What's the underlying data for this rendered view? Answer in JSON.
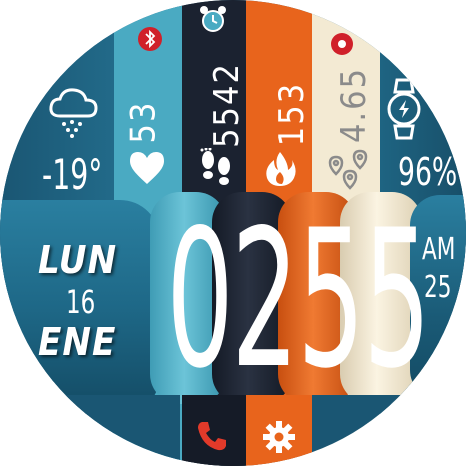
{
  "weather": {
    "icon": "cloud-snow-icon",
    "temperature": "-19°"
  },
  "heart_rate": {
    "icon": "heart-icon",
    "value": "53"
  },
  "steps": {
    "icon": "footsteps-icon",
    "value": "5542"
  },
  "calories": {
    "icon": "flame-icon",
    "value": "153"
  },
  "distance": {
    "icon": "location-pins-icon",
    "value": "4.65"
  },
  "battery": {
    "icon": "watch-battery-icon",
    "value": "96%"
  },
  "status_icons": {
    "bluetooth": "bluetooth-icon",
    "alarm": "alarm-clock-icon",
    "notification": "notification-dot-icon"
  },
  "date": {
    "weekday": "LUN",
    "day": "16",
    "month": "ENE"
  },
  "time": {
    "h1": "0",
    "h2": "2",
    "m1": "5",
    "m2": "5",
    "ampm": "AM",
    "seconds": "25"
  },
  "shortcuts": {
    "phone": "phone-icon",
    "settings": "gear-icon"
  },
  "colors": {
    "teal": "#1c5f7c",
    "light_blue": "#4fb0c6",
    "navy": "#1b2230",
    "orange": "#e8641c",
    "cream": "#f3ead3",
    "red_dot": "#d0202a"
  }
}
